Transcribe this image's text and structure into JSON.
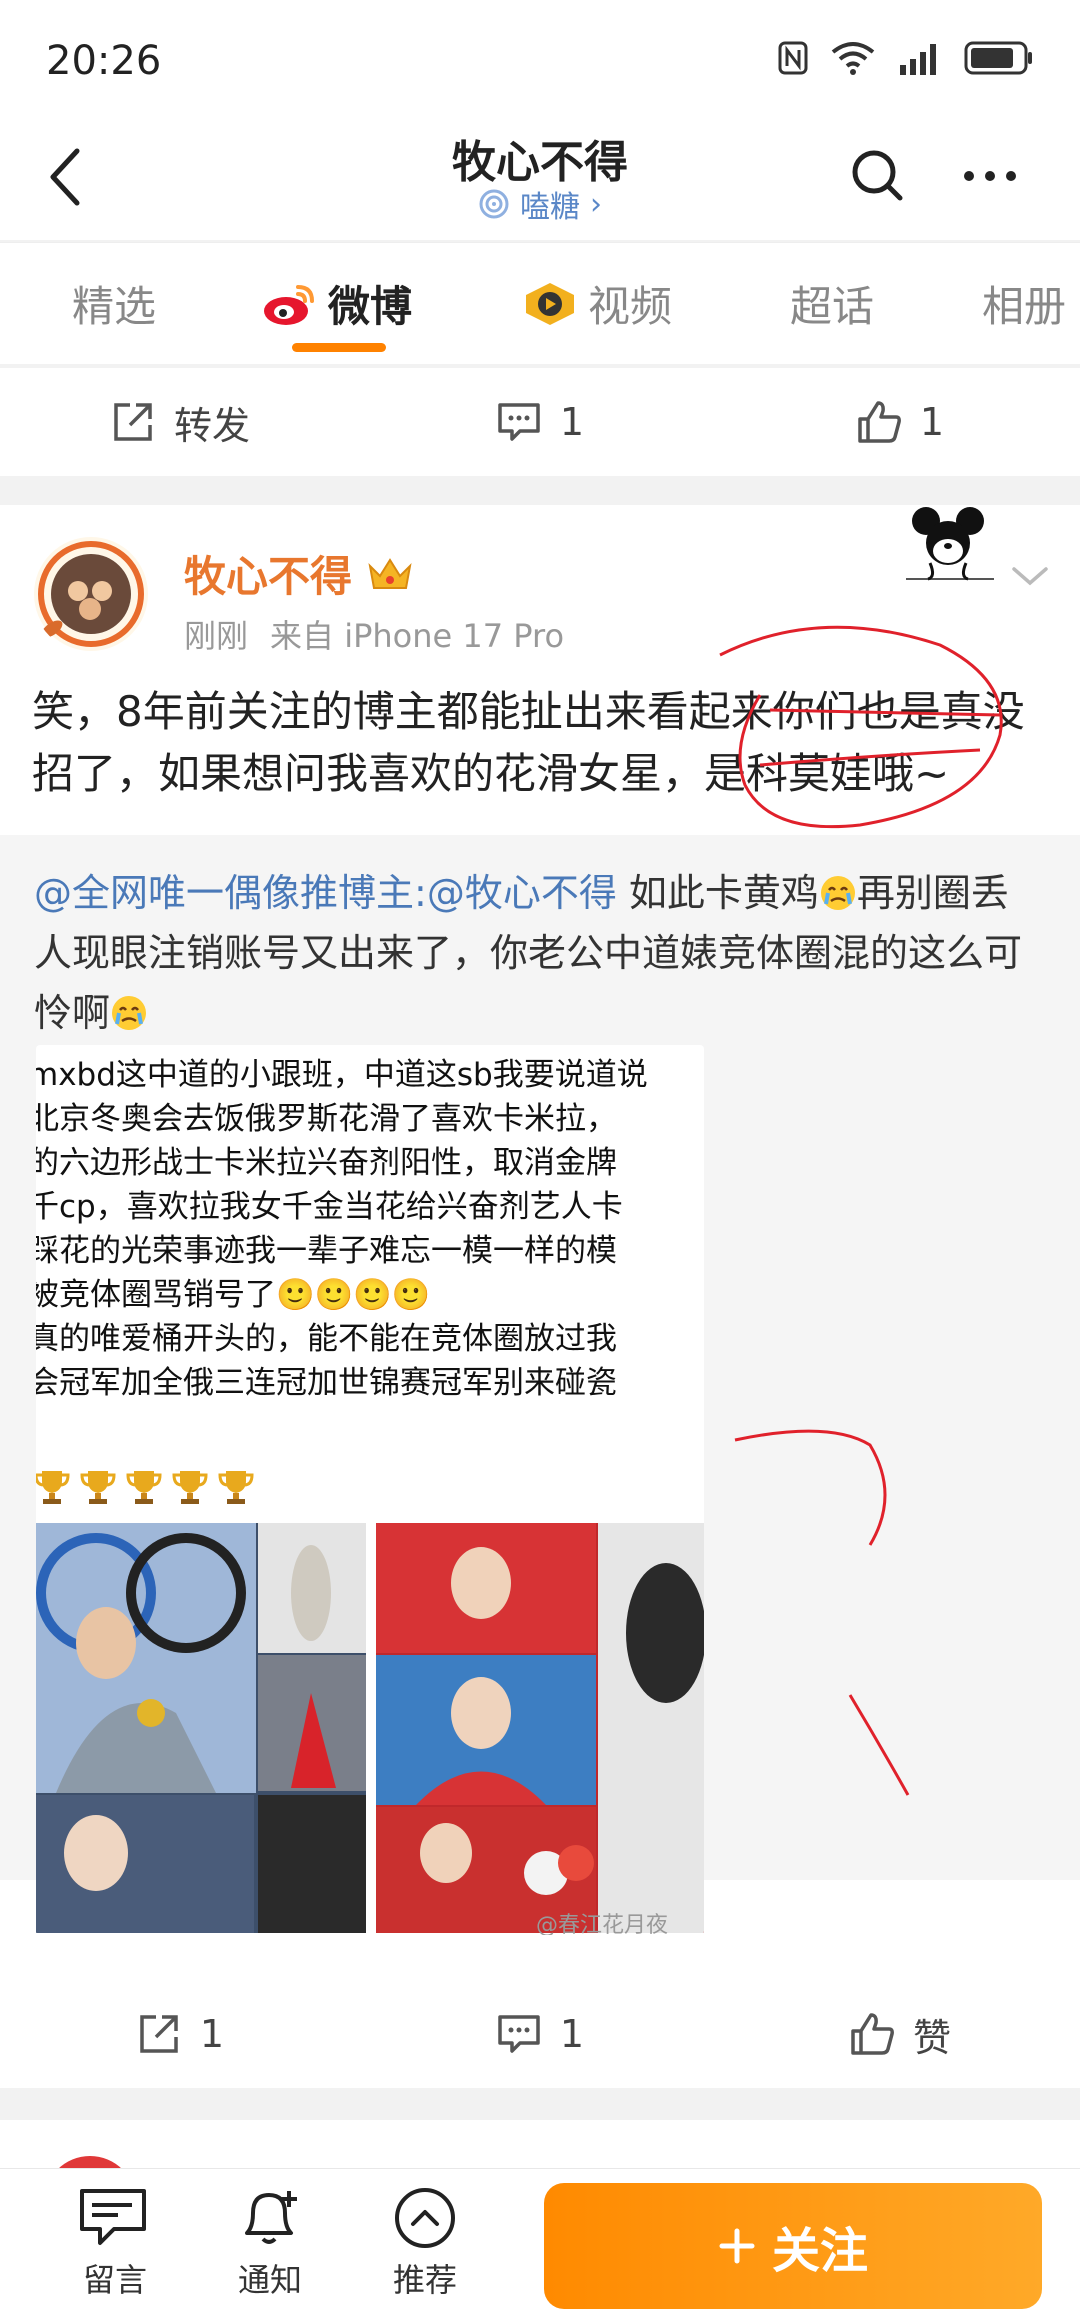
{
  "status_bar": {
    "time": "20:26"
  },
  "nav": {
    "title": "牧心不得",
    "subtitle": "嗑糖"
  },
  "tabs": [
    {
      "label": "精选"
    },
    {
      "label": "微博"
    },
    {
      "label": "视频"
    },
    {
      "label": "超话"
    },
    {
      "label": "相册"
    }
  ],
  "prev_post_actions": {
    "repost": "转发",
    "comments": "1",
    "likes": "1"
  },
  "post": {
    "user_name": "牧心不得",
    "time": "刚刚",
    "source": "来自 iPhone 17 Pro",
    "text": "笑，8年前关注的博主都能扯出来看起来你们也是真没招了，如果想问我喜欢的花滑女星，是科莫娃哦~",
    "repost": {
      "mention1": "@全网唯一偶像推博主",
      "mention2": ":@牧心不得",
      "text_a": " 如此卡黄鸡",
      "text_b": "再别圈丢人现眼注销账号又出来了，你老公中道婊竞体圈混的这么可怜啊",
      "image_lines": [
        "mxbd这中道的小跟班，中道这sb我要说道说",
        "北京冬奥会去饭俄罗斯花滑了喜欢卡米拉，",
        "的六边形战士卡米拉兴奋剂阳性，取消金牌",
        "千cp，喜欢拉我女千金当花给兴奋剂艺人卡",
        "踩花的光荣事迹我一辈子难忘一模一样的模",
        "被竞体圈骂销号了🙂🙂🙂🙂",
        "真的唯爱桶开头的，能不能在竞体圈放过我",
        "会冠军加全俄三连冠加世锦赛冠军别来碰瓷"
      ],
      "image_watermark": "@春江花月夜"
    },
    "actions": {
      "reposts": "1",
      "comments": "1",
      "like_label": "赞"
    }
  },
  "bottom_bar": {
    "comment_label": "留言",
    "notify_label": "通知",
    "recommend_label": "推荐",
    "follow_label": "关注"
  },
  "colors": {
    "accent": "#ff8200",
    "mention": "#4a79b8",
    "username": "#e8772e",
    "annotation": "#e0212b"
  }
}
